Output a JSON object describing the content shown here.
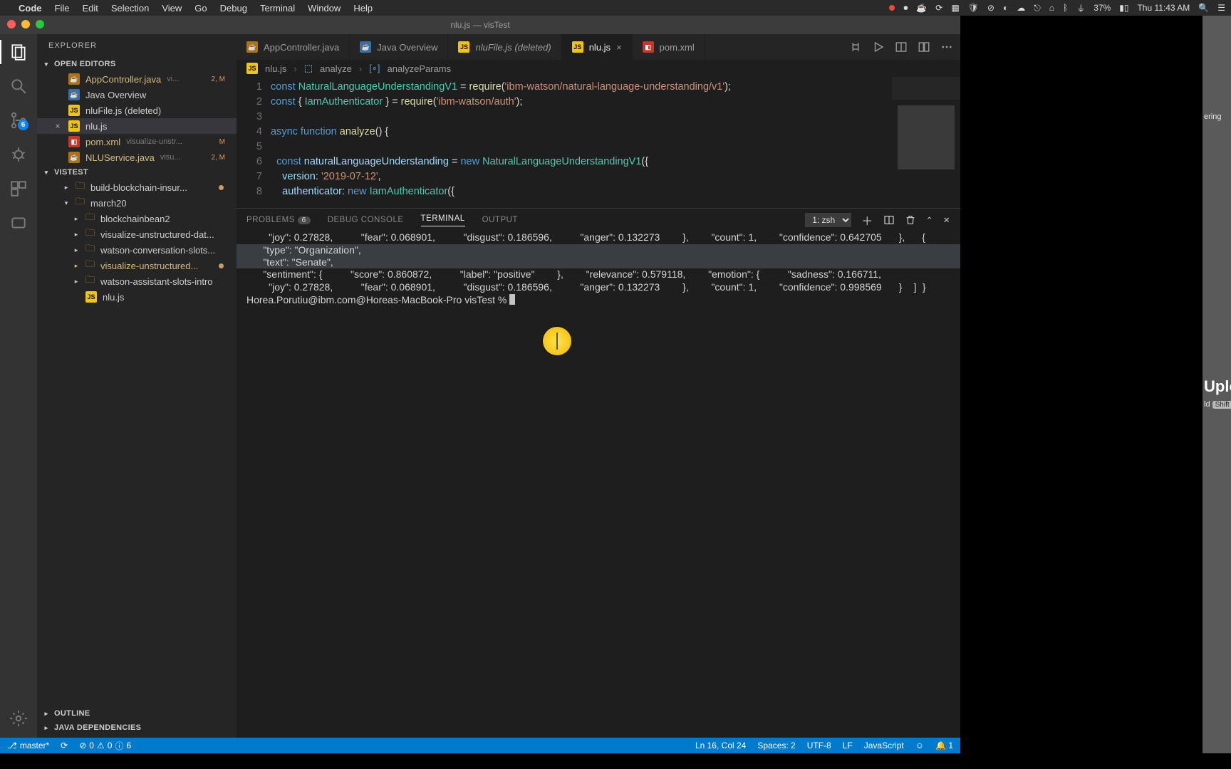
{
  "mac": {
    "app": "Code",
    "menus": [
      "File",
      "Edit",
      "Selection",
      "View",
      "Go",
      "Debug",
      "Terminal",
      "Window",
      "Help"
    ],
    "battery": "37%",
    "clock": "Thu 11:43 AM"
  },
  "vscode": {
    "title": "nlu.js — visTest",
    "explorer_title": "EXPLORER",
    "open_editors_label": "OPEN EDITORS",
    "open_editors": [
      {
        "icon": "java",
        "name": "AppController.java",
        "meta": "vi...",
        "badge": "2, M",
        "gold": true
      },
      {
        "icon": "md",
        "name": "Java Overview"
      },
      {
        "icon": "js",
        "name": "nluFile.js (deleted)"
      },
      {
        "icon": "js",
        "name": "nlu.js",
        "active": true,
        "close": true
      },
      {
        "icon": "xml",
        "name": "pom.xml",
        "meta": "visualize-unstr...",
        "badge": "M",
        "gold": true
      },
      {
        "icon": "java",
        "name": "NLUService.java",
        "meta": "visu...",
        "badge": "2, M",
        "gold": true
      }
    ],
    "workspace_label": "VISTEST",
    "tree": [
      {
        "kind": "folder",
        "name": "build-blockchain-insur...",
        "dot": true,
        "depth": 1
      },
      {
        "kind": "folder",
        "name": "march20",
        "open": true,
        "depth": 1
      },
      {
        "kind": "folder",
        "name": "blockchainbean2",
        "depth": 2
      },
      {
        "kind": "folder",
        "name": "visualize-unstructured-dat...",
        "depth": 2
      },
      {
        "kind": "folder",
        "name": "watson-conversation-slots...",
        "depth": 2
      },
      {
        "kind": "folder",
        "name": "visualize-unstructured...",
        "gold": true,
        "dot": true,
        "depth": 2
      },
      {
        "kind": "folder",
        "name": "watson-assistant-slots-intro",
        "depth": 2
      },
      {
        "kind": "file",
        "icon": "js",
        "name": "nlu.js",
        "depth": 2
      }
    ],
    "outline_label": "OUTLINE",
    "java_deps_label": "JAVA DEPENDENCIES",
    "activity_badge": "6",
    "tabs": [
      {
        "icon": "java",
        "label": "AppController.java"
      },
      {
        "icon": "md",
        "label": "Java Overview"
      },
      {
        "icon": "js",
        "label": "nluFile.js (deleted)",
        "italic": true
      },
      {
        "icon": "js",
        "label": "nlu.js",
        "active": true,
        "close": true
      },
      {
        "icon": "xml",
        "label": "pom.xml"
      }
    ],
    "crumbs": [
      "nlu.js",
      "analyze",
      "analyzeParams"
    ],
    "code": {
      "lines": [
        {
          "n": 1,
          "html": "<span class='tok-kw'>const</span> <span class='tok-cls'>NaturalLanguageUnderstandingV1</span> <span class='tok-op'>=</span> <span class='tok-fn'>require</span>(<span class='tok-str'>'ibm-watson/natural-language-understanding/v1'</span>);"
        },
        {
          "n": 2,
          "html": "<span class='tok-kw'>const</span> { <span class='tok-cls'>IamAuthenticator</span> } <span class='tok-op'>=</span> <span class='tok-fn'>require</span>(<span class='tok-str'>'ibm-watson/auth'</span>);"
        },
        {
          "n": 3,
          "html": ""
        },
        {
          "n": 4,
          "html": "<span class='tok-kw'>async</span> <span class='tok-kw'>function</span> <span class='tok-fn'>analyze</span>() {"
        },
        {
          "n": 5,
          "html": ""
        },
        {
          "n": 6,
          "html": "  <span class='tok-kw'>const</span> <span class='tok-id'>naturalLanguageUnderstanding</span> <span class='tok-op'>=</span> <span class='tok-kw'>new</span> <span class='tok-cls'>NaturalLanguageUnderstandingV1</span>({"
        },
        {
          "n": 7,
          "html": "    <span class='tok-id'>version</span>: <span class='tok-str'>'2019-07-12'</span>,"
        },
        {
          "n": 8,
          "html": "    <span class='tok-id'>authenticator</span>: <span class='tok-kw'>new</span> <span class='tok-cls'>IamAuthenticator</span>({"
        }
      ]
    },
    "panel": {
      "tabs": {
        "problems": "PROBLEMS",
        "problems_count": "6",
        "debug": "DEBUG CONSOLE",
        "terminal": "TERMINAL",
        "output": "OUTPUT"
      },
      "term_select": "1: zsh",
      "term_lines": [
        "        \"joy\": 0.27828,",
        "        \"fear\": 0.068901,",
        "        \"disgust\": 0.186596,",
        "        \"anger\": 0.132273",
        "      },",
        "      \"count\": 1,",
        "      \"confidence\": 0.642705",
        "    },",
        "    {",
        "      \"type\": \"Organization\",",
        "      \"text\": \"Senate\",",
        "      \"sentiment\": {",
        "        \"score\": 0.860872,",
        "        \"label\": \"positive\"",
        "      },",
        "      \"relevance\": 0.579118,",
        "      \"emotion\": {",
        "        \"sadness\": 0.166711,",
        "        \"joy\": 0.27828,",
        "        \"fear\": 0.068901,",
        "        \"disgust\": 0.186596,",
        "        \"anger\": 0.132273",
        "      },",
        "      \"count\": 1,",
        "      \"confidence\": 0.998569",
        "    }",
        "  ]",
        "}",
        ""
      ],
      "prompt": "Horea.Porutiu@ibm.com@Horeas-MacBook-Pro visTest % "
    },
    "status": {
      "branch": "master*",
      "errors": "0",
      "warnings": "0",
      "info": "6",
      "cursor": "Ln 16, Col 24",
      "spaces": "Spaces: 2",
      "enc": "UTF-8",
      "eol": "LF",
      "lang": "JavaScript",
      "feedback": "☺",
      "bell": "1"
    }
  },
  "bg_hints": [
    "ering",
    "",
    "",
    "",
    "",
    "",
    "Uploa",
    "ld",
    "Shift"
  ]
}
